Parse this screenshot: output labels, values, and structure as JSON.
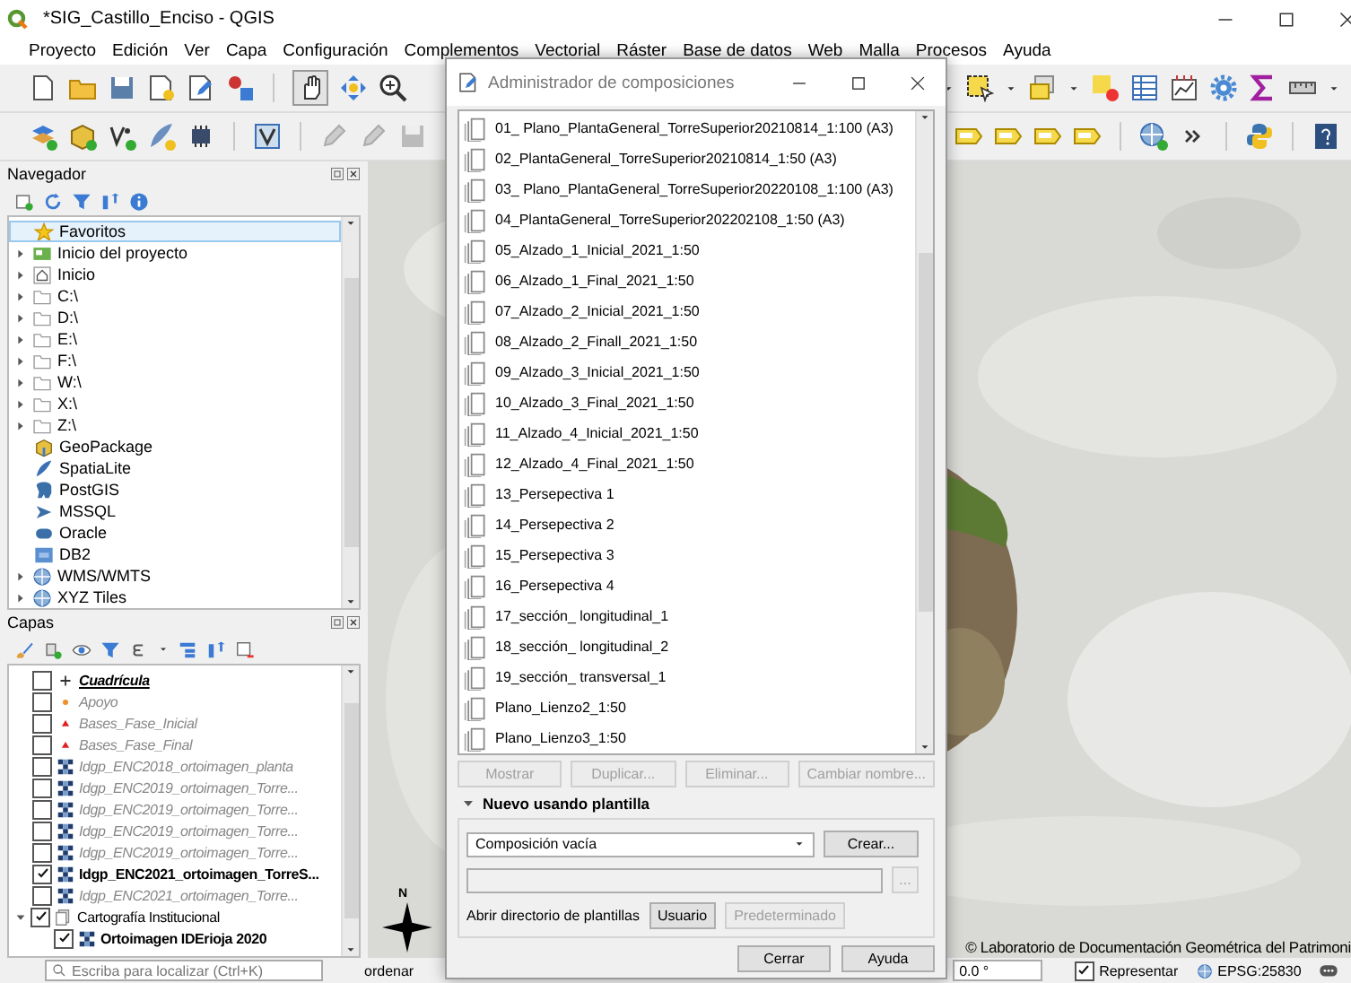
{
  "window": {
    "title": "*SIG_Castillo_Enciso - QGIS"
  },
  "menu": [
    "Proyecto",
    "Edición",
    "Ver",
    "Capa",
    "Configuración",
    "Complementos",
    "Vectorial",
    "Ráster",
    "Base de datos",
    "Web",
    "Malla",
    "Procesos",
    "Ayuda"
  ],
  "navigator": {
    "title": "Navegador",
    "items": [
      {
        "label": "Favoritos",
        "kind": "star",
        "selected": true
      },
      {
        "label": "Inicio del proyecto",
        "kind": "project",
        "expanded": false,
        "selected": false
      },
      {
        "label": "Inicio",
        "kind": "home",
        "expanded": false,
        "selected": false
      },
      {
        "label": "C:\\",
        "kind": "folder",
        "expanded": false,
        "selected": false
      },
      {
        "label": "D:\\",
        "kind": "folder",
        "expanded": false,
        "selected": false
      },
      {
        "label": "E:\\",
        "kind": "folder",
        "expanded": false,
        "selected": false
      },
      {
        "label": "F:\\",
        "kind": "folder",
        "expanded": false,
        "selected": false
      },
      {
        "label": "W:\\",
        "kind": "folder",
        "expanded": false,
        "selected": false
      },
      {
        "label": "X:\\",
        "kind": "folder",
        "expanded": false,
        "selected": false
      },
      {
        "label": "Z:\\",
        "kind": "folder",
        "expanded": false,
        "selected": false
      },
      {
        "label": "GeoPackage",
        "kind": "geopackage",
        "selected": false
      },
      {
        "label": "SpatiaLite",
        "kind": "spatialite",
        "selected": false
      },
      {
        "label": "PostGIS",
        "kind": "postgis",
        "selected": false
      },
      {
        "label": "MSSQL",
        "kind": "mssql",
        "selected": false
      },
      {
        "label": "Oracle",
        "kind": "oracle",
        "selected": false
      },
      {
        "label": "DB2",
        "kind": "db2",
        "selected": false
      },
      {
        "label": "WMS/WMTS",
        "kind": "wms",
        "expanded": false,
        "selected": false
      },
      {
        "label": "XYZ Tiles",
        "kind": "wms",
        "expanded": false,
        "selected": false
      }
    ]
  },
  "layers": {
    "title": "Capas",
    "items": [
      {
        "label": "Cuadrícula",
        "kind": "grid",
        "checked": false
      },
      {
        "label": "Apoyo",
        "kind": "point",
        "checked": false
      },
      {
        "label": "Bases_Fase_Inicial",
        "kind": "triangle",
        "checked": false
      },
      {
        "label": "Bases_Fase_Final",
        "kind": "triangle",
        "checked": false
      },
      {
        "label": "Idgp_ENC2018_ortoimagen_planta",
        "kind": "raster",
        "checked": false
      },
      {
        "label": "Idgp_ENC2019_ortoimagen_Torre...",
        "kind": "raster",
        "checked": false
      },
      {
        "label": "Idgp_ENC2019_ortoimagen_Torre...",
        "kind": "raster",
        "checked": false
      },
      {
        "label": "Idgp_ENC2019_ortoimagen_Torre...",
        "kind": "raster",
        "checked": false
      },
      {
        "label": "Idgp_ENC2019_ortoimagen_Torre...",
        "kind": "raster",
        "checked": false
      },
      {
        "label": "Idgp_ENC2021_ortoimagen_TorreS...",
        "kind": "raster",
        "checked": true
      },
      {
        "label": "Idgp_ENC2021_ortoimagen_Torre...",
        "kind": "raster",
        "checked": false
      },
      {
        "label": "Cartografía Institucional",
        "kind": "group",
        "checked": true,
        "expanded": true,
        "children": [
          {
            "label": "Ortoimagen IDErioja 2020",
            "kind": "raster",
            "checked": true
          }
        ]
      }
    ]
  },
  "map": {
    "north_label": "N",
    "attribution": "© Laboratorio de Documentación Geométrica del Patrimoni"
  },
  "status_bar": {
    "search_placeholder": "Escriba para localizar (Ctrl+K)",
    "coordinate_label": "ordenar",
    "rotation": "0.0 °",
    "render": {
      "label": "Representar",
      "checked": true
    },
    "crs": "EPSG:25830"
  },
  "dialog": {
    "title": "Administrador de composiciones",
    "layouts": [
      {
        "name": "01_ Plano_PlantaGeneral_TorreSuperior20210814_1:100 (A3)",
        "selected": false
      },
      {
        "name": "02_PlantaGeneral_TorreSuperior20210814_1:50 (A3)",
        "selected": false
      },
      {
        "name": "03_ Plano_PlantaGeneral_TorreSuperior20220108_1:100 (A3)",
        "selected": false
      },
      {
        "name": "04_PlantaGeneral_TorreSuperior202202108_1:50 (A3)",
        "selected": false
      },
      {
        "name": "05_Alzado_1_Inicial_2021_1:50",
        "selected": false
      },
      {
        "name": "06_Alzado_1_Final_2021_1:50",
        "selected": false
      },
      {
        "name": "07_Alzado_2_Inicial_2021_1:50",
        "selected": false
      },
      {
        "name": "08_Alzado_2_Finall_2021_1:50",
        "selected": false
      },
      {
        "name": "09_Alzado_3_Inicial_2021_1:50",
        "selected": false
      },
      {
        "name": "10_Alzado_3_Final_2021_1:50",
        "selected": false
      },
      {
        "name": "11_Alzado_4_Inicial_2021_1:50",
        "selected": false
      },
      {
        "name": "12_Alzado_4_Final_2021_1:50",
        "selected": false
      },
      {
        "name": "13_Persepectiva 1",
        "selected": false
      },
      {
        "name": "14_Persepectiva 2",
        "selected": false
      },
      {
        "name": "15_Persepectiva 3",
        "selected": false
      },
      {
        "name": "16_Persepectiva 4",
        "selected": false
      },
      {
        "name": "17_sección_ longitudinal_1",
        "selected": false
      },
      {
        "name": "18_sección_ longitudinal_2",
        "selected": false
      },
      {
        "name": "19_sección_ transversal_1",
        "selected": false
      },
      {
        "name": "Plano_Lienzo2_1:50",
        "selected": false
      },
      {
        "name": "Plano_Lienzo3_1:50",
        "selected": false
      }
    ],
    "buttons": [
      {
        "label": "Mostrar",
        "disabled": true
      },
      {
        "label": "Duplicar...",
        "disabled": true
      },
      {
        "label": "Eliminar...",
        "disabled": true
      },
      {
        "label": "Cambiar nombre...",
        "disabled": true
      }
    ],
    "template_section": {
      "label": "Nuevo usando plantilla",
      "expanded": true
    },
    "template": {
      "value": "Composición vacía",
      "create": "Crear...",
      "browse": "...",
      "dir_label": "Abrir directorio de plantillas",
      "dir_buttons": [
        {
          "label": "Usuario",
          "disabled": false
        },
        {
          "label": "Predeterminado",
          "disabled": true
        }
      ]
    },
    "footer_buttons": [
      "Cerrar",
      "Ayuda"
    ]
  }
}
